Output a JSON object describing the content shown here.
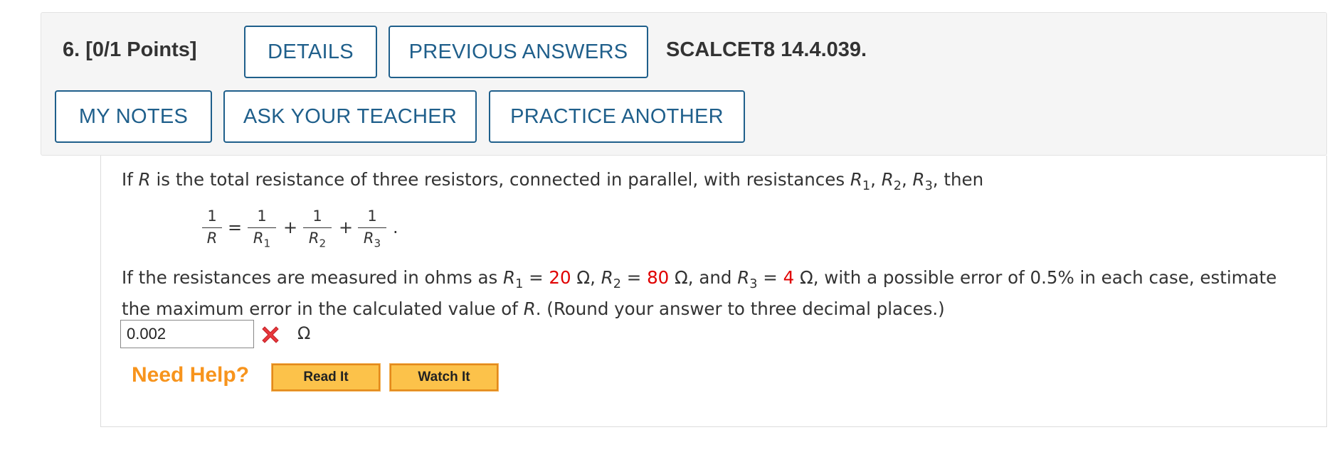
{
  "header": {
    "question_number": "6.",
    "points": "[0/1 Points]",
    "details_label": "DETAILS",
    "previous_answers_label": "PREVIOUS ANSWERS",
    "problem_id": "SCALCET8 14.4.039.",
    "my_notes_label": "MY NOTES",
    "ask_teacher_label": "ASK YOUR TEACHER",
    "practice_another_label": "PRACTICE ANOTHER"
  },
  "question": {
    "intro_prefix": "If ",
    "intro_var": "R",
    "intro_middle": " is the total resistance of three resistors, connected in parallel, with resistances ",
    "intro_suffix": ", then",
    "formula_numerator": "1",
    "formula_lhs_den": "R",
    "eq_sign": "=",
    "plus_sign": "+",
    "formula_end": ".",
    "r_var": "R",
    "sub1": "1",
    "sub2": "2",
    "sub3": "3",
    "line2_prefix": "If the resistances are measured in ohms as ",
    "r1_value": "20",
    "r2_value": "80",
    "r3_value": "4",
    "ohm": "Ω",
    "line2_suffix": ", with a possible error of 0.5% in each case, estimate",
    "line3_prefix": "the maximum error in the calculated value of ",
    "line3_suffix": ". (Round your answer to three decimal places.)"
  },
  "answer": {
    "value": "0.002",
    "status_icon": "incorrect-x-icon",
    "unit": "Ω"
  },
  "help": {
    "label": "Need Help?",
    "read_it": "Read It",
    "watch_it": "Watch It"
  },
  "colors": {
    "button_border": "#1f5f8b",
    "given_value": "#e00000",
    "need_help": "#f7941d",
    "help_button_bg": "#fcc24a"
  }
}
